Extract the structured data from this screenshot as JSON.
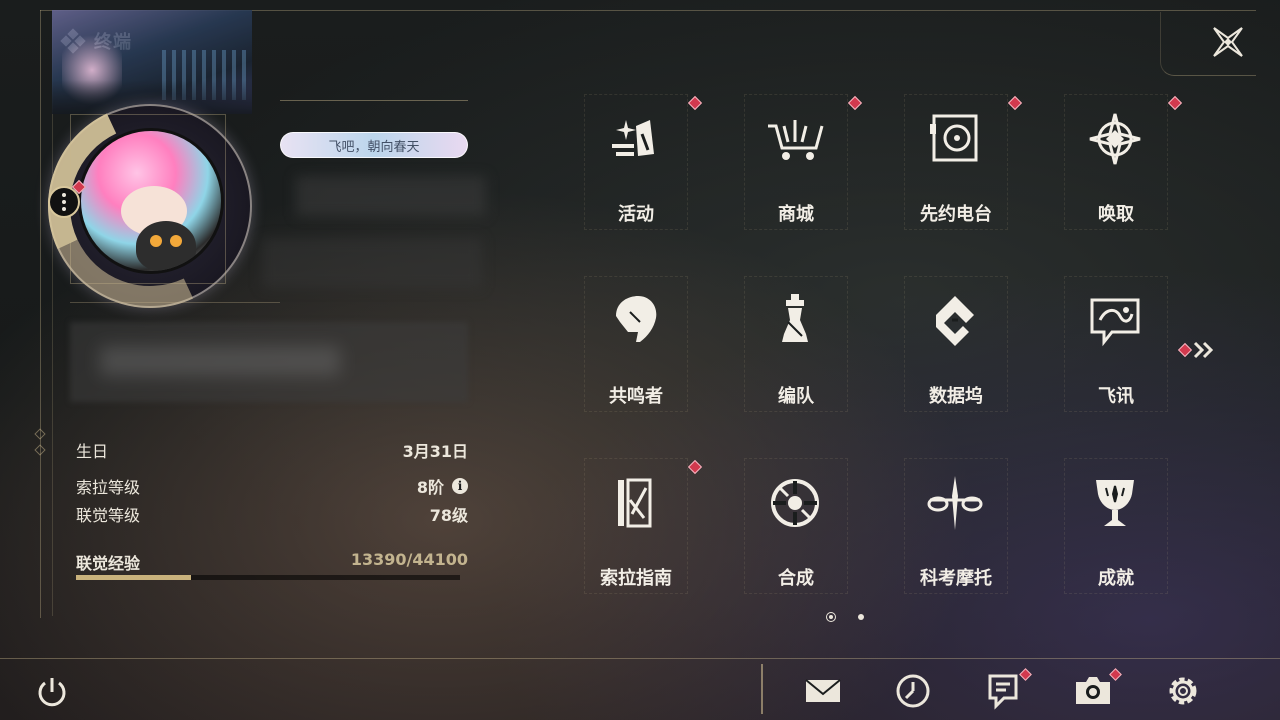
{
  "header": {
    "title": "终端"
  },
  "profile": {
    "signature": "飞吧，朝向春天",
    "stats": [
      {
        "label": "生日",
        "value": "3月31日",
        "info": false
      },
      {
        "label": "索拉等级",
        "value": "8阶",
        "info": true
      },
      {
        "label": "联觉等级",
        "value": "78级",
        "info": false
      }
    ],
    "exp": {
      "label": "联觉经验",
      "current": 13390,
      "max": 44100,
      "text": "13390/44100",
      "progress": 0.3
    }
  },
  "menu": [
    {
      "label": "活动",
      "icon": "activity-icon",
      "badge": true
    },
    {
      "label": "商城",
      "icon": "shop-icon",
      "badge": true
    },
    {
      "label": "先约电台",
      "icon": "radio-icon",
      "badge": true
    },
    {
      "label": "唤取",
      "icon": "convene-icon",
      "badge": true
    },
    {
      "label": "共鸣者",
      "icon": "resonator-icon",
      "badge": false
    },
    {
      "label": "编队",
      "icon": "team-icon",
      "badge": false
    },
    {
      "label": "数据坞",
      "icon": "data-bank-icon",
      "badge": false
    },
    {
      "label": "飞讯",
      "icon": "chat-icon",
      "badge": false
    },
    {
      "label": "索拉指南",
      "icon": "guidebook-icon",
      "badge": true
    },
    {
      "label": "合成",
      "icon": "synthesis-icon",
      "badge": false
    },
    {
      "label": "科考摩托",
      "icon": "motorcycle-icon",
      "badge": false
    },
    {
      "label": "成就",
      "icon": "achievement-icon",
      "badge": false
    }
  ],
  "pagination": {
    "current": 1,
    "total": 2
  },
  "bottom_bar": [
    {
      "icon": "mail-icon",
      "badge": false
    },
    {
      "icon": "clock-icon",
      "badge": false
    },
    {
      "icon": "notice-icon",
      "badge": true
    },
    {
      "icon": "camera-icon",
      "badge": true
    },
    {
      "icon": "settings-icon",
      "badge": false
    }
  ],
  "colors": {
    "accent": "#c9b27c",
    "badge": "#d2394e",
    "text": "#ece7dc"
  }
}
